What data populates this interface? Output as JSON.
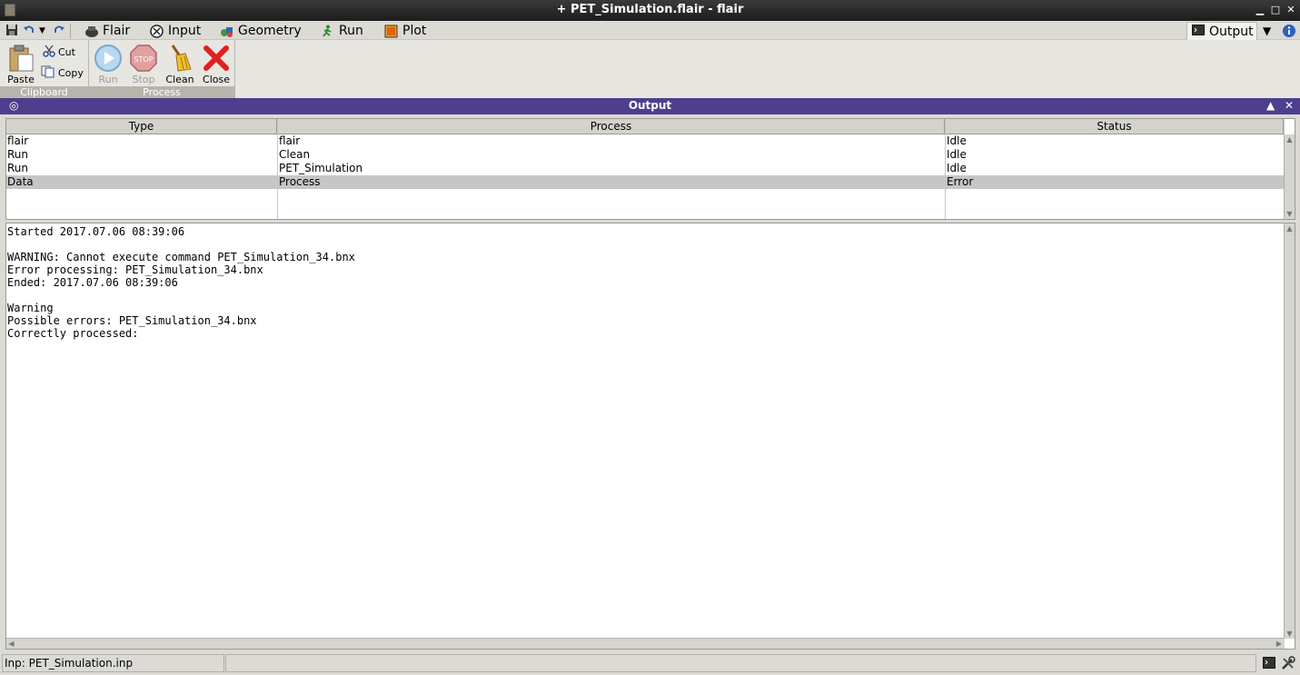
{
  "window": {
    "title": "+ PET_Simulation.flair - flair",
    "minimize": "▁",
    "maximize": "□",
    "close": "✕"
  },
  "menubar": {
    "tabs": [
      {
        "label": "Flair",
        "icon": "flair-icon"
      },
      {
        "label": "Input",
        "icon": "input-icon"
      },
      {
        "label": "Geometry",
        "icon": "geometry-icon"
      },
      {
        "label": "Run",
        "icon": "run-icon"
      },
      {
        "label": "Plot",
        "icon": "plot-icon"
      }
    ],
    "active_tab": "Output",
    "dropdown": "▼"
  },
  "ribbon": {
    "clipboard": {
      "label": "Clipboard",
      "paste": "Paste",
      "cut": "Cut",
      "copy": "Copy"
    },
    "process": {
      "label": "Process",
      "run": "Run",
      "stop": "Stop",
      "clean": "Clean",
      "close": "Close"
    }
  },
  "panel": {
    "title": "Output",
    "up": "▲",
    "close": "✕"
  },
  "table": {
    "headers": [
      "Type",
      "Process",
      "Status"
    ],
    "rows": [
      {
        "type": "flair",
        "process": "flair",
        "status": "Idle"
      },
      {
        "type": "Run",
        "process": "Clean",
        "status": "Idle"
      },
      {
        "type": "Run",
        "process": "PET_Simulation",
        "status": "Idle"
      },
      {
        "type": "Data",
        "process": "Process",
        "status": "Error"
      }
    ],
    "selected_row": 3
  },
  "log": {
    "lines": "Started 2017.07.06 08:39:06\n\nWARNING: Cannot execute command PET_Simulation_34.bnx\nError processing: PET_Simulation_34.bnx\nEnded: 2017.07.06 08:39:06\n\nWarning\nPossible errors: PET_Simulation_34.bnx\nCorrectly processed:"
  },
  "statusbar": {
    "input_file": "Inp: PET_Simulation.inp"
  },
  "colors": {
    "panel_header": "#4e3f8e",
    "selected_row": "#c6c6c6",
    "close_red": "#e02020"
  }
}
